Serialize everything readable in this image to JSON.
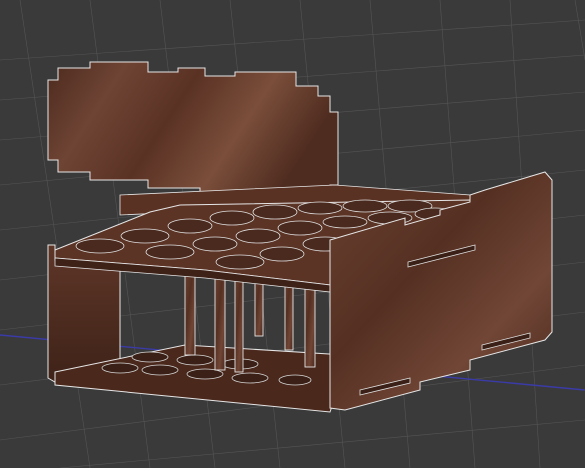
{
  "viewport": {
    "background_color": "#3a3a3a",
    "grid_color": "#6a6a6a",
    "axis_x_color": "#3a3aa8"
  },
  "model": {
    "material": "walnut-plywood",
    "edge_color": "#e6e6e6",
    "wood_colors": [
      "#5a3224",
      "#6e4434",
      "#4a2a1e",
      "#7a4e3a"
    ],
    "parts": [
      "lid-panel",
      "left-side-panel",
      "right-side-panel",
      "top-plate-with-holes",
      "bottom-plate-with-holes",
      "divider-posts"
    ]
  }
}
